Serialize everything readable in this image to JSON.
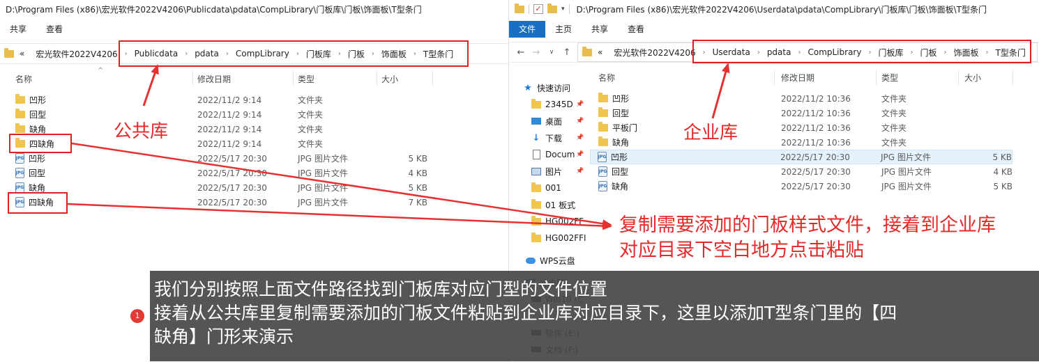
{
  "left_window": {
    "title_path": "D:\\Program Files (x86)\\宏光软件2022V4206\\Publicdata\\pdata\\CompLibrary\\门板库\\门板\\饰面板\\T型条门",
    "ribbon_tabs": [
      "共享",
      "查看"
    ],
    "address_prefix": "«",
    "breadcrumbs": [
      "宏光软件2022V4206",
      "Publicdata",
      "pdata",
      "CompLibrary",
      "门板库",
      "门板",
      "饰面板",
      "T型条门"
    ],
    "columns": {
      "name": "名称",
      "date": "修改日期",
      "type": "类型",
      "size": "大小"
    },
    "files": [
      {
        "name": "凹形",
        "kind": "folder",
        "date": "2022/11/2 9:14",
        "type": "文件夹",
        "size": ""
      },
      {
        "name": "回型",
        "kind": "folder",
        "date": "2022/11/2 9:14",
        "type": "文件夹",
        "size": ""
      },
      {
        "name": "缺角",
        "kind": "folder",
        "date": "2022/11/2 9:14",
        "type": "文件夹",
        "size": ""
      },
      {
        "name": "四缺角",
        "kind": "folder",
        "date": "2022/11/2 9:14",
        "type": "文件夹",
        "size": ""
      },
      {
        "name": "凹形",
        "kind": "jpg",
        "date": "2022/5/17 20:30",
        "type": "JPG 图片文件",
        "size": "5 KB"
      },
      {
        "name": "回型",
        "kind": "jpg",
        "date": "2022/5/17 20:30",
        "type": "JPG 图片文件",
        "size": "4 KB"
      },
      {
        "name": "缺角",
        "kind": "jpg",
        "date": "2022/5/17 20:30",
        "type": "JPG 图片文件",
        "size": "5 KB"
      },
      {
        "name": "四缺角",
        "kind": "jpg",
        "date": "2022/5/17 20:30",
        "type": "JPG 图片文件",
        "size": "7 KB"
      }
    ]
  },
  "right_window": {
    "title_path": "D:\\Program Files (x86)\\宏光软件2022V4206\\Userdata\\pdata\\CompLibrary\\门板库\\门板\\饰面板\\T型条门",
    "ribbon_tabs": [
      "文件",
      "主页",
      "共享",
      "查看"
    ],
    "address_prefix": "«",
    "breadcrumbs": [
      "宏光软件2022V4206",
      "Userdata",
      "pdata",
      "CompLibrary",
      "门板库",
      "门板",
      "饰面板",
      "T型条门"
    ],
    "columns": {
      "name": "名称",
      "date": "修改日期",
      "type": "类型",
      "size": "大小"
    },
    "sidebar": [
      {
        "label": "快速访问",
        "icon": "star-icon"
      },
      {
        "label": "2345D",
        "icon": "folder-icon",
        "pinned": true
      },
      {
        "label": "桌面",
        "icon": "desktop-icon",
        "pinned": true
      },
      {
        "label": "下载",
        "icon": "download-icon",
        "pinned": true
      },
      {
        "label": "Docum",
        "icon": "document-icon",
        "pinned": true
      },
      {
        "label": "图片",
        "icon": "picture-icon",
        "pinned": true
      },
      {
        "label": "001",
        "icon": "folder-icon"
      },
      {
        "label": "01 板式",
        "icon": "folder-icon"
      },
      {
        "label": "HG002FF",
        "icon": "folder-icon"
      },
      {
        "label": "HG002FFI",
        "icon": "folder-icon"
      },
      {
        "label": "WPS云盘",
        "icon": "cloud-icon"
      },
      {
        "label": "此电脑",
        "icon": "pc-icon"
      },
      {
        "label": "Win10 (C",
        "icon": "drive-icon"
      },
      {
        "label": "软件 (E:)",
        "icon": "drive-icon"
      },
      {
        "label": "文档 (F:)",
        "icon": "drive-icon"
      }
    ],
    "files": [
      {
        "name": "凹形",
        "kind": "folder",
        "date": "2022/11/2 10:36",
        "type": "文件夹",
        "size": ""
      },
      {
        "name": "回型",
        "kind": "folder",
        "date": "2022/11/2 10:36",
        "type": "文件夹",
        "size": ""
      },
      {
        "name": "平板门",
        "kind": "folder",
        "date": "2022/11/2 10:36",
        "type": "文件夹",
        "size": ""
      },
      {
        "name": "缺角",
        "kind": "folder",
        "date": "2022/11/2 10:36",
        "type": "文件夹",
        "size": ""
      },
      {
        "name": "凹形",
        "kind": "jpg",
        "date": "2022/5/17 20:30",
        "type": "JPG 图片文件",
        "size": "5 KB"
      },
      {
        "name": "回型",
        "kind": "jpg",
        "date": "2022/5/17 20:30",
        "type": "JPG 图片文件",
        "size": "4 KB"
      },
      {
        "name": "缺角",
        "kind": "jpg",
        "date": "2022/5/17 20:30",
        "type": "JPG 图片文件",
        "size": "5 KB"
      }
    ]
  },
  "annotations": {
    "public_lib": "公共库",
    "enterprise_lib": "企业库",
    "instruction_line1": "复制需要添加的门板样式文件，接着到企业库",
    "instruction_line2": "对应目录下空白地方点击粘贴"
  },
  "caption": {
    "badge": "1",
    "line1": "我们分别按照上面文件路径找到门板库对应门型的文件位置",
    "line2": "接着从公共库里复制需要添加的门板文件粘贴到企业库对应目录下，这里以添加T型条门里的【四",
    "line3": "缺角】门形来演示"
  },
  "colors": {
    "annotation_red": "#e02020",
    "ribbon_active": "#1a6fc3",
    "folder": "#f0c54f"
  }
}
